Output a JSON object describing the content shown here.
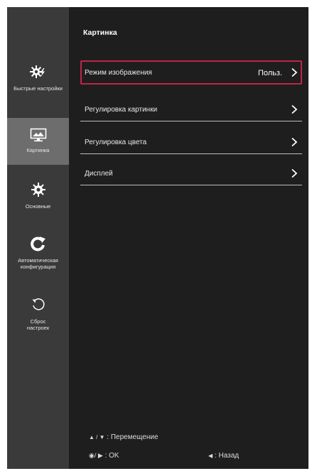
{
  "sidebar": {
    "items": [
      {
        "label": "Быстрые настройки",
        "icon": "quick-settings-icon"
      },
      {
        "label": "Картинка",
        "icon": "picture-icon"
      },
      {
        "label": "Основные",
        "icon": "gear-icon"
      },
      {
        "label_line1": "Автоматическая",
        "label_line2": "конфигурация",
        "icon": "auto-config-icon"
      },
      {
        "label_line1": "Сброс",
        "label_line2": "настроек",
        "icon": "reset-icon"
      }
    ]
  },
  "main": {
    "title": "Картинка",
    "menu": [
      {
        "label": "Режим изображения",
        "value": "Польз.",
        "selected": true
      },
      {
        "label": "Регулировка картинки"
      },
      {
        "label": "Регулировка цвета"
      },
      {
        "label": "Дисплей"
      }
    ]
  },
  "hints": {
    "move_keys": "▲ / ▼",
    "move_label": ": Перемещение",
    "ok_keys": "◉/ ▶",
    "ok_label": ": OK",
    "back_key": "◀",
    "back_label": ": Назад"
  },
  "colors": {
    "background": "#1e1e1e",
    "sidebar": "#3a3a3a",
    "sidebar_active": "#6d6d6d",
    "selection_border": "#c0234e"
  }
}
